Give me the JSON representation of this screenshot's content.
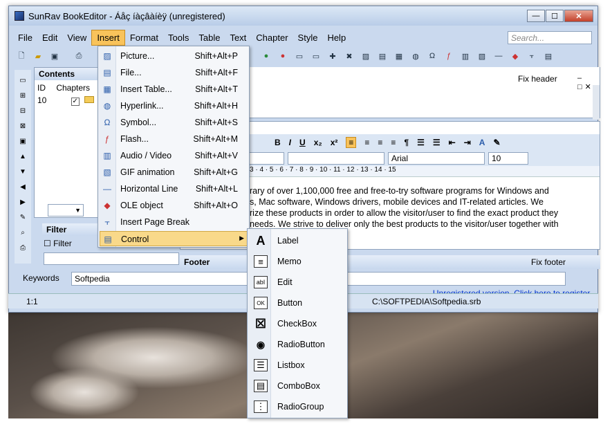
{
  "window": {
    "title": "SunRav BookEditor - Áåç íàçâàíèÿ (unregistered)",
    "buttons": {
      "min": "—",
      "max": "☐",
      "close": "✕"
    }
  },
  "menubar": {
    "items": [
      "File",
      "Edit",
      "View",
      "Insert",
      "Format",
      "Tools",
      "Table",
      "Text",
      "Chapter",
      "Style",
      "Help"
    ],
    "active": "Insert",
    "search_placeholder": "Search..."
  },
  "contents_panel": {
    "title": "Contents",
    "columns": [
      "ID",
      "Chapters"
    ],
    "row": {
      "id": "10"
    }
  },
  "header_panel": {
    "fix_label": "Fix header"
  },
  "filter_panel": {
    "title": "Filter",
    "checkbox_label": "Filter"
  },
  "editor": {
    "font_name": "Arial",
    "font_size": "10",
    "ruler": "3 · 4 · 5 · 6 · 7 · 8 · 9 · 10 · 11 · 12 · 13 · 14 · 15",
    "text_lines": [
      "rary of over 1,100,000 free and free-to-try software programs for Windows and",
      "s, Mac software, Windows drivers, mobile devices and IT-related articles. We",
      "rize these products in order to allow the visitor/user to find the exact product they",
      "needs. We strive to deliver only the best products to the visitor/user together with"
    ]
  },
  "footer_panel": {
    "title": "Footer",
    "fix_label": "Fix footer"
  },
  "keywords": {
    "label": "Keywords",
    "value": "Softpedia"
  },
  "unregistered_link": "Unregistered version. Click here to register.",
  "status": {
    "position": "1:1",
    "path": "C:\\SOFTPEDIA\\Softpedia.srb"
  },
  "insert_menu": [
    {
      "label": "Picture...",
      "shortcut": "Shift+Alt+P",
      "icon": "picture-icon"
    },
    {
      "label": "File...",
      "shortcut": "Shift+Alt+F",
      "icon": "file-icon"
    },
    {
      "label": "Insert Table...",
      "shortcut": "Shift+Alt+T",
      "icon": "table-icon"
    },
    {
      "label": "Hyperlink...",
      "shortcut": "Shift+Alt+H",
      "icon": "hyperlink-icon"
    },
    {
      "label": "Symbol...",
      "shortcut": "Shift+Alt+S",
      "icon": "omega-icon"
    },
    {
      "label": "Flash...",
      "shortcut": "Shift+Alt+M",
      "icon": "flash-icon"
    },
    {
      "label": "Audio / Video",
      "shortcut": "Shift+Alt+V",
      "icon": "media-icon"
    },
    {
      "label": "GIF animation",
      "shortcut": "Shift+Alt+G",
      "icon": "gif-icon"
    },
    {
      "label": "Horizontal Line",
      "shortcut": "Shift+Alt+L",
      "icon": "line-icon"
    },
    {
      "label": "OLE object",
      "shortcut": "Shift+Alt+O",
      "icon": "ole-icon"
    },
    {
      "label": "Insert Page Break",
      "shortcut": "",
      "icon": "page-break-icon"
    },
    {
      "label": "Control",
      "shortcut": "",
      "icon": "control-icon"
    }
  ],
  "control_submenu": [
    {
      "label": "Label",
      "icon": "label-icon",
      "glyph": "A"
    },
    {
      "label": "Memo",
      "icon": "memo-icon",
      "glyph": "≡"
    },
    {
      "label": "Edit",
      "icon": "edit-icon",
      "glyph": "abI"
    },
    {
      "label": "Button",
      "icon": "button-icon",
      "glyph": "OK"
    },
    {
      "label": "CheckBox",
      "icon": "checkbox-icon",
      "glyph": "☒"
    },
    {
      "label": "RadioButton",
      "icon": "radiobutton-icon",
      "glyph": "◉"
    },
    {
      "label": "Listbox",
      "icon": "listbox-icon",
      "glyph": "☰"
    },
    {
      "label": "ComboBox",
      "icon": "combobox-icon",
      "glyph": "▤"
    },
    {
      "label": "RadioGroup",
      "icon": "radiogroup-icon",
      "glyph": "⋮"
    }
  ]
}
